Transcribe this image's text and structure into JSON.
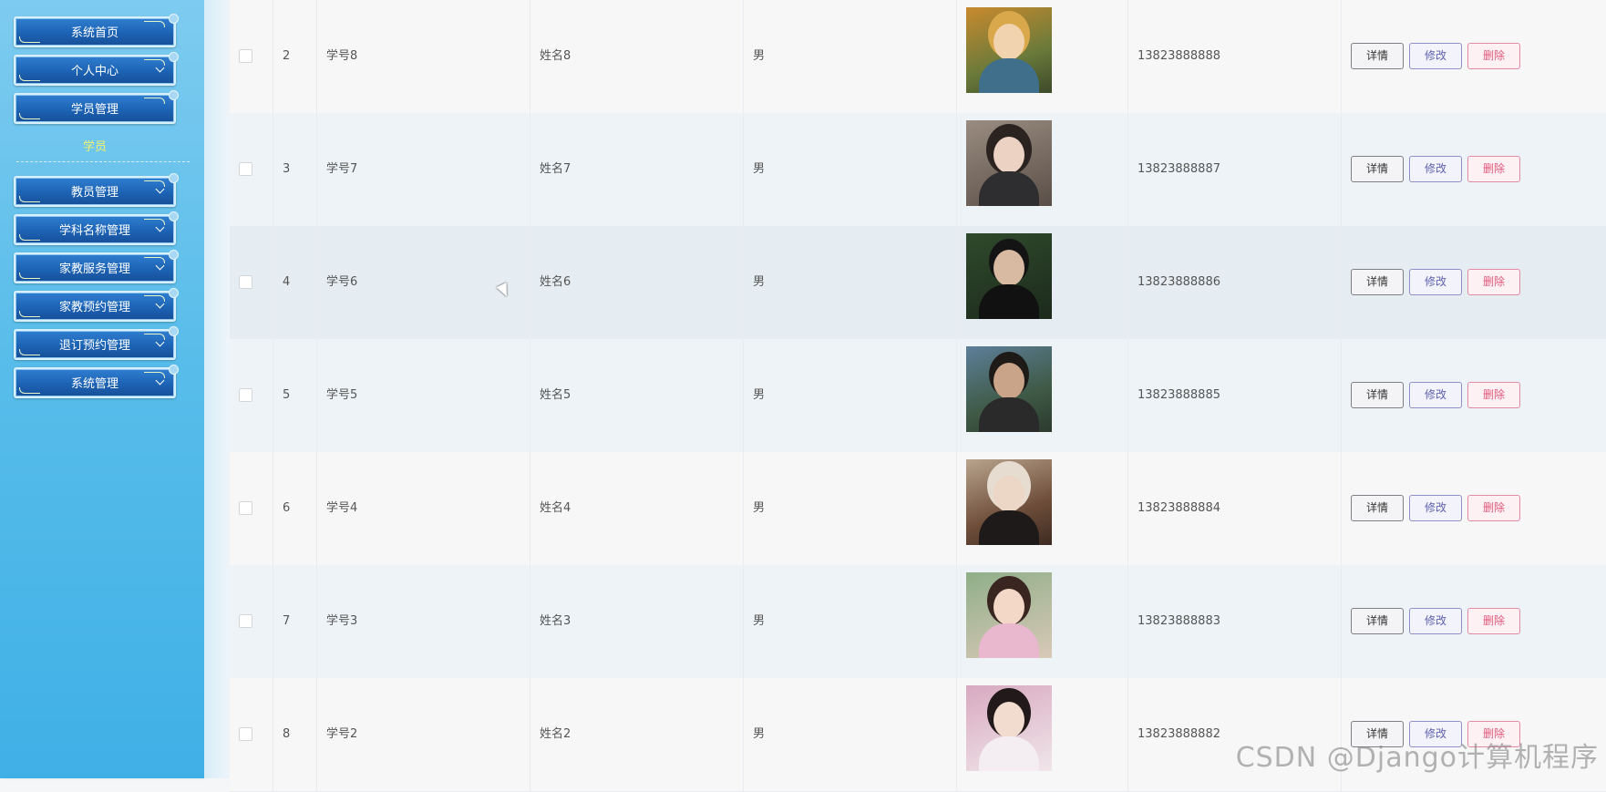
{
  "sidebar": {
    "menu": [
      {
        "label": "系统首页",
        "chevron": false
      },
      {
        "label": "个人中心",
        "chevron": true
      },
      {
        "label": "学员管理",
        "chevron": false
      },
      {
        "label": "教员管理",
        "chevron": true
      },
      {
        "label": "学科名称管理",
        "chevron": true
      },
      {
        "label": "家教服务管理",
        "chevron": true
      },
      {
        "label": "家教预约管理",
        "chevron": true
      },
      {
        "label": "退订预约管理",
        "chevron": true
      },
      {
        "label": "系统管理",
        "chevron": true
      }
    ],
    "submenu": {
      "label": "学员"
    }
  },
  "table": {
    "buttons": {
      "detail": "详情",
      "edit": "修改",
      "delete": "删除"
    },
    "rows": [
      {
        "index": "2",
        "student_id": "学号8",
        "name": "姓名8",
        "sex": "男",
        "phone": "13823888888",
        "photo": "avatar-anime"
      },
      {
        "index": "3",
        "student_id": "学号7",
        "name": "姓名7",
        "sex": "男",
        "phone": "13823888887",
        "photo": "avatar-woman"
      },
      {
        "index": "4",
        "student_id": "学号6",
        "name": "姓名6",
        "sex": "男",
        "phone": "13823888886",
        "photo": "avatar-man-reading"
      },
      {
        "index": "5",
        "student_id": "学号5",
        "name": "姓名5",
        "sex": "男",
        "phone": "13823888885",
        "photo": "avatar-man-outdoor"
      },
      {
        "index": "6",
        "student_id": "学号4",
        "name": "姓名4",
        "sex": "男",
        "phone": "13823888884",
        "photo": "avatar-woman-hat"
      },
      {
        "index": "7",
        "student_id": "学号3",
        "name": "姓名3",
        "sex": "男",
        "phone": "13823888883",
        "photo": "avatar-woman-pink"
      },
      {
        "index": "8",
        "student_id": "学号2",
        "name": "姓名2",
        "sex": "男",
        "phone": "13823888882",
        "photo": "avatar-woman-selfie"
      }
    ]
  },
  "watermark": "CSDN @Django计算机程序",
  "colors": {
    "sidebar_top": "#7ecbf0",
    "sidebar_bottom": "#3fb0e6",
    "menu_button": "#1d63b4",
    "submenu_text": "#f2f26a",
    "edit": "#5f62ad",
    "delete": "#e0587c"
  }
}
